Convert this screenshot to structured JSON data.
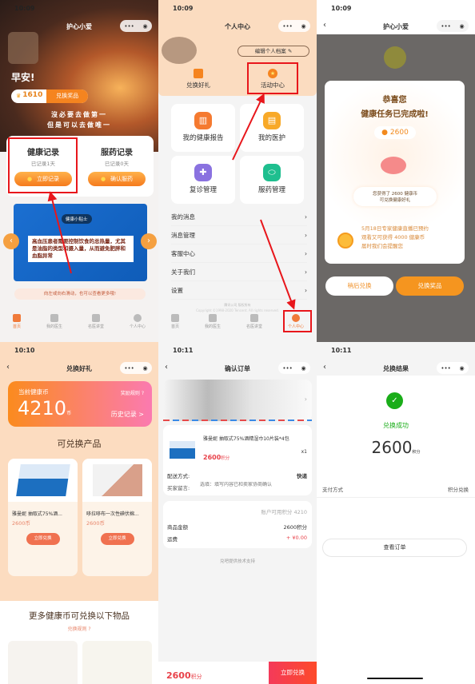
{
  "screens": {
    "home": {
      "time": "10:09",
      "title": "护心小爱",
      "greeting": "早安!",
      "coins": "1610",
      "redeem_btn": "兑换奖品",
      "slogan1": "沒必要去做第一",
      "slogan2": "但是可以去做唯一",
      "health_record": {
        "title": "健康记录",
        "sub": "已记录1天",
        "btn": "立即记录"
      },
      "med_record": {
        "title": "服药记录",
        "sub": "已记录0天",
        "btn": "确认服药"
      },
      "tip_tag": "健康小贴士",
      "tip_text": "高血压患者需要控制饮食的总热量，尤其是油脂的类型和摄入量，从而避免肥胖和血脂异常",
      "hint": "向左或向右滑动，也可以查看更多哦!",
      "tabs": [
        "首页",
        "我的医生",
        "名医讲堂",
        "个人中心"
      ]
    },
    "profile": {
      "time": "10:09",
      "title": "个人中心",
      "edit_btn": "编辑个人档案",
      "gift": "兑换好礼",
      "activity": "活动中心",
      "grid": [
        "我的健康报告",
        "我的医护",
        "复诊管理",
        "服药管理"
      ],
      "menu": [
        "我的消息",
        "消息管理",
        "客服中心",
        "关于我们",
        "设置"
      ],
      "footer1": "腾讯公司 版权所有",
      "footer2": "Copyright ©1998-2020 Tencent. All rights reserved.",
      "tabs": [
        "首页",
        "我的医生",
        "名医讲堂",
        "个人中心"
      ]
    },
    "reward": {
      "time": "10:09",
      "title": "护心小爱",
      "congrats1": "恭喜您",
      "congrats2": "健康任务已完成啦!",
      "coin_amount": "2600",
      "gain1": "您获得了 2600 健康币",
      "gain2": "可兑换健康好礼",
      "notice1": "5月18日专家健康直播已预约",
      "notice2": "观看又可获得 4000 健康币",
      "notice3": "届时我们会提醒您",
      "later_btn": "稍后兑换",
      "redeem_btn": "兑换奖品"
    },
    "gifts": {
      "time": "10:10",
      "title": "兑换好礼",
      "balance_label": "当前健康币",
      "rules": "奖励规则",
      "balance": "4210",
      "unit": "币",
      "history": "历史记录 >",
      "section": "可兑换产品",
      "products": [
        {
          "name": "雅曼妮 抽取式75%酒...",
          "price": "2600币",
          "btn": "立即兑换"
        },
        {
          "name": "哆拉哆布一次性碘伏棉...",
          "price": "2600币",
          "btn": "立即兑换"
        }
      ],
      "more": "更多健康币可兑换以下物品",
      "more_rules": "兑换规则"
    },
    "order": {
      "time": "10:11",
      "title": "确认订单",
      "product": "雅曼妮 抽取式75%酒精湿巾10片装*4包",
      "price": "2600",
      "price_unit": "积分",
      "qty": "x1",
      "delivery_label": "配送方式:",
      "delivery": "快递",
      "note_label": "买家留言:",
      "note_placeholder": "选填：填写内容已和卖家协商确认",
      "available": "账户可用积分 4210",
      "amount_label": "商品金额",
      "amount": "2600积分",
      "shipping_label": "运费",
      "shipping": "+ ¥0.00",
      "support": "兑吧提供技术支持",
      "total": "2600",
      "total_unit": "积分",
      "submit": "立即兑换"
    },
    "result": {
      "time": "10:11",
      "title": "兑换结果",
      "status": "兑换成功",
      "amount": "2600",
      "unit": "积分",
      "pay_label": "支付方式",
      "pay": "积分兑换",
      "view_btn": "查看订单"
    }
  },
  "colors": {
    "accent": "#f5841f",
    "annotation": "#e8161b",
    "success": "#1aad19",
    "price": "#e8424a"
  }
}
